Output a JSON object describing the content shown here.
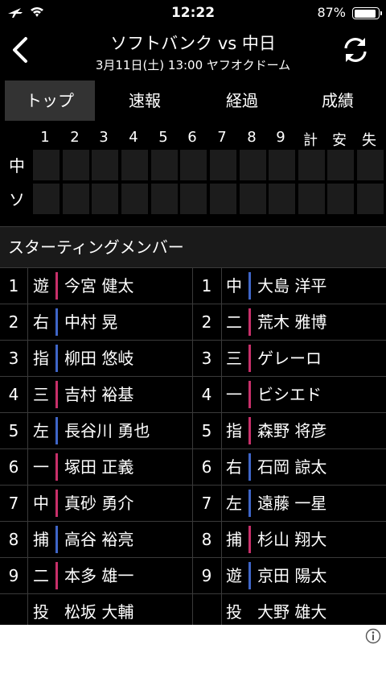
{
  "status": {
    "time": "12:22",
    "battery": "87%",
    "battery_level": 0.87
  },
  "header": {
    "title": "ソフトバンク vs 中日",
    "subtitle": "3月11日(土) 13:00 ヤフオクドーム"
  },
  "tabs": [
    {
      "label": "トップ",
      "active": true
    },
    {
      "label": "速報",
      "active": false
    },
    {
      "label": "経過",
      "active": false
    },
    {
      "label": "成績",
      "active": false
    }
  ],
  "scoreboard": {
    "columns": [
      "1",
      "2",
      "3",
      "4",
      "5",
      "6",
      "7",
      "8",
      "9",
      "計",
      "安",
      "失"
    ],
    "teams": [
      "中",
      "ソ"
    ]
  },
  "section_title": "スターティングメンバー",
  "lineup": {
    "home": [
      {
        "order": "1",
        "pos": "遊",
        "name": "今宮 健太"
      },
      {
        "order": "2",
        "pos": "右",
        "name": "中村 晃"
      },
      {
        "order": "3",
        "pos": "指",
        "name": "柳田 悠岐"
      },
      {
        "order": "4",
        "pos": "三",
        "name": "吉村 裕基"
      },
      {
        "order": "5",
        "pos": "左",
        "name": "長谷川 勇也"
      },
      {
        "order": "6",
        "pos": "一",
        "name": "塚田 正義"
      },
      {
        "order": "7",
        "pos": "中",
        "name": "真砂 勇介"
      },
      {
        "order": "8",
        "pos": "捕",
        "name": "高谷 裕亮"
      },
      {
        "order": "9",
        "pos": "二",
        "name": "本多 雄一"
      },
      {
        "order": "",
        "pos": "投",
        "name": "松坂 大輔"
      }
    ],
    "away": [
      {
        "order": "1",
        "pos": "中",
        "name": "大島 洋平"
      },
      {
        "order": "2",
        "pos": "二",
        "name": "荒木 雅博"
      },
      {
        "order": "3",
        "pos": "三",
        "name": "ゲレーロ"
      },
      {
        "order": "4",
        "pos": "一",
        "name": "ビシエド"
      },
      {
        "order": "5",
        "pos": "指",
        "name": "森野 将彦"
      },
      {
        "order": "6",
        "pos": "右",
        "name": "石岡 諒太"
      },
      {
        "order": "7",
        "pos": "左",
        "name": "遠藤 一星"
      },
      {
        "order": "8",
        "pos": "捕",
        "name": "杉山 翔大"
      },
      {
        "order": "9",
        "pos": "遊",
        "name": "京田 陽太"
      },
      {
        "order": "",
        "pos": "投",
        "name": "大野 雄大"
      }
    ],
    "bar_colors": [
      "#c8306a",
      "#3f66c8",
      "#3f66c8",
      "#c8306a",
      "#3f66c8",
      "#c8306a",
      "#c8306a",
      "#3f66c8",
      "#c8306a",
      "none"
    ],
    "bar_colors_away": [
      "#3f66c8",
      "#c8306a",
      "#c8306a",
      "#c8306a",
      "#c8306a",
      "#3f66c8",
      "#3f66c8",
      "#c8306a",
      "#3f66c8",
      "none"
    ]
  }
}
